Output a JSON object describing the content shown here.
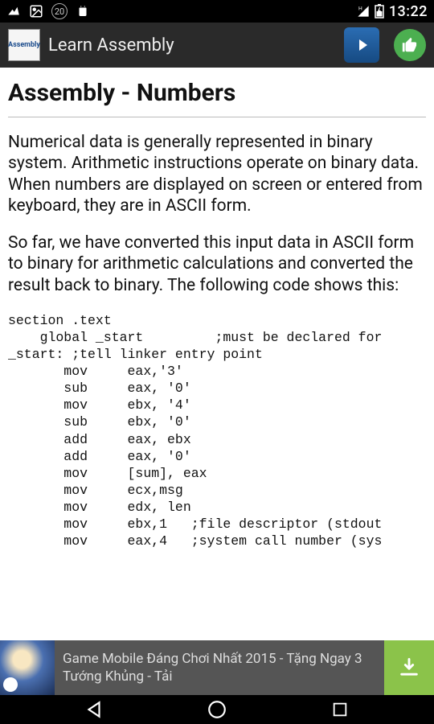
{
  "status": {
    "badge_count": "20",
    "time": "13:22"
  },
  "appbar": {
    "logo_text": "Assembly",
    "title": "Learn Assembly"
  },
  "content": {
    "heading": "Assembly - Numbers",
    "para1": "Numerical data is generally represented in binary system. Arithmetic instructions operate on binary data. When numbers are displayed on screen or entered from keyboard, they are in ASCII form.",
    "para2": "So far, we have converted this input data in ASCII form to binary for arithmetic calculations and converted the result back to binary. The following code shows this:",
    "code": "section .text\n    global _start         ;must be declared for \n_start: ;tell linker entry point\n       mov     eax,'3'\n       sub     eax, '0'\n       mov     ebx, '4'\n       sub     ebx, '0'\n       add     eax, ebx\n       add     eax, '0'\n       mov     [sum], eax\n       mov     ecx,msg\n       mov     edx, len\n       mov     ebx,1   ;file descriptor (stdout\n       mov     eax,4   ;system call number (sys"
  },
  "ad": {
    "text": "Game Mobile Đáng Chơi Nhất 2015 - Tặng Ngay 3 Tướng Khủng - Tải"
  }
}
